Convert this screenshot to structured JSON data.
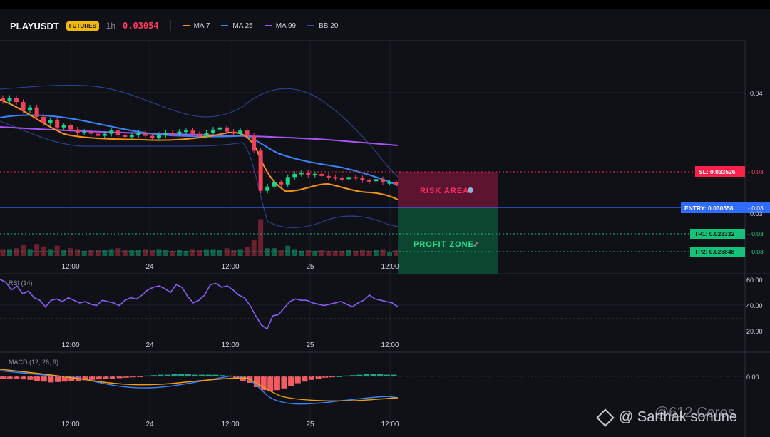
{
  "header": {
    "symbol": "PLAYUSDT",
    "badge": "FUTURES",
    "timeframe": "1h",
    "price": "0.03054",
    "legend": [
      {
        "label": "MA 7",
        "color": "#f7931a"
      },
      {
        "label": "MA 25",
        "color": "#3b82f6"
      },
      {
        "label": "MA 99",
        "color": "#a855f7"
      },
      {
        "label": "BB 20",
        "color": "#2d4aa8"
      }
    ]
  },
  "main_pane": {
    "y_axis_labels": [
      "0.04",
      "0.03"
    ],
    "x_axis_labels": [
      "12:00",
      "24",
      "12:00",
      "25",
      "12:00"
    ],
    "zones": {
      "risk_label": "RISK AREA",
      "profit_label": "PROFIT ZONE"
    },
    "price_tags": [
      {
        "label": "SL: 0.033526",
        "suffix": "- 0.03",
        "color": "#ff1f4b"
      },
      {
        "label": "ENTRY: 0.030558",
        "suffix": "- 0.03",
        "color": "#2f6bff"
      },
      {
        "label": "TP1: 0.028332",
        "suffix": "- 0.03",
        "color": "#15c27a"
      },
      {
        "label": "TP2: 0.026848",
        "suffix": "- 0.03",
        "color": "#15c27a"
      }
    ]
  },
  "rsi_pane": {
    "label": "RSI (14)",
    "y_axis_labels": [
      "60.00",
      "40.00",
      "20.00"
    ],
    "x_axis_labels": [
      "12:00",
      "24",
      "12:00",
      "25",
      "12:00"
    ],
    "line_color": "#8b5cf6"
  },
  "macd_pane": {
    "label": "MACD (12, 26, 9)",
    "y_axis_labels": [
      "0.00"
    ],
    "x_axis_labels": [
      "12:00",
      "24",
      "12:00",
      "25",
      "12:00"
    ]
  },
  "watermark": {
    "text": "@ Sarthak sonune",
    "secondary": "@612 Ceros"
  },
  "chart_data": {
    "type": "line",
    "title": "",
    "candles_close": [
      0.0399,
      0.0402,
      0.0398,
      0.039,
      0.0393,
      0.0384,
      0.0378,
      0.0381,
      0.0374,
      0.0376,
      0.0372,
      0.0369,
      0.037,
      0.0368,
      0.0366,
      0.0368,
      0.0371,
      0.0367,
      0.0365,
      0.0367,
      0.0369,
      0.0366,
      0.0364,
      0.0367,
      0.0369,
      0.0368,
      0.037,
      0.0371,
      0.0368,
      0.0366,
      0.0369,
      0.0372,
      0.0374,
      0.037,
      0.0368,
      0.0371,
      0.0366,
      0.0352,
      0.0314,
      0.0318,
      0.0322,
      0.032,
      0.0327,
      0.033,
      0.0331,
      0.0329,
      0.033,
      0.0328,
      0.0327,
      0.0326,
      0.0325,
      0.0327,
      0.0326,
      0.0324,
      0.0323,
      0.0325,
      0.0322,
      0.0322,
      0.032
    ],
    "levels": {
      "SL": 0.033526,
      "ENTRY": 0.030558,
      "TP1": 0.028332,
      "TP2": 0.026848
    },
    "rsi_ylim": [
      15,
      65
    ],
    "rsi_values": [
      60,
      58,
      52,
      55,
      49,
      51,
      46,
      44,
      39,
      44,
      45,
      43,
      46,
      44,
      42,
      43,
      41,
      40,
      44,
      43,
      42,
      40,
      44,
      46,
      45,
      48,
      52,
      54,
      55,
      53,
      50,
      56,
      54,
      47,
      42,
      44,
      48,
      56,
      57,
      54,
      55,
      52,
      48,
      46,
      40,
      32,
      25,
      22,
      32,
      33,
      38,
      43,
      45,
      44,
      44,
      42,
      41,
      40,
      41,
      42,
      43,
      41,
      39,
      42,
      44,
      48,
      45,
      44,
      43,
      42,
      39
    ],
    "macd_ylim": [
      -0.0006,
      0.0003
    ],
    "macd_hist": [
      -5e-05,
      -5e-05,
      -6e-05,
      -7e-05,
      -8e-05,
      -0.0001,
      -0.00012,
      -0.00014,
      -0.00013,
      -0.00012,
      -0.00011,
      -0.0001,
      -9e-05,
      -8e-05,
      -7e-05,
      -6e-05,
      -5e-05,
      -4e-05,
      -3e-05,
      -2e-05,
      -1e-05,
      2e-05,
      3e-05,
      4e-05,
      4e-05,
      5e-05,
      5e-05,
      5e-05,
      4e-05,
      4e-05,
      4e-05,
      4e-05,
      3e-05,
      2e-05,
      -5e-05,
      -0.0001,
      -0.00015,
      -0.00025,
      -0.00032,
      -0.00035,
      -0.00032,
      -0.00028,
      -0.00022,
      -0.00016,
      -0.00012,
      -8e-05,
      -5e-05,
      -3e-05,
      -2e-05,
      0.0,
      2e-05,
      3e-05,
      4e-05,
      5e-05,
      5e-05,
      5e-05,
      4e-05,
      4e-05
    ]
  }
}
